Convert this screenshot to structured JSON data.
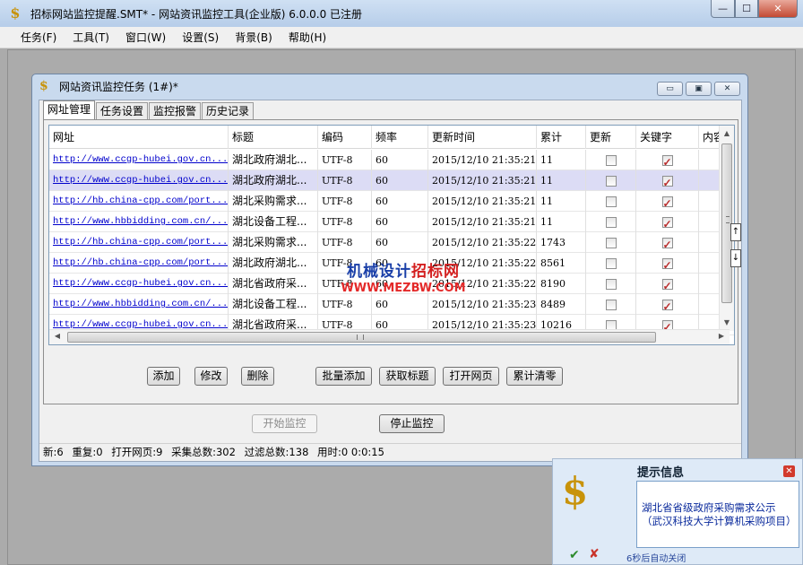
{
  "window": {
    "title": "招标网站监控提醒.SMT* - 网站资讯监控工具(企业版) 6.0.0.0  已注册",
    "min_label": "—",
    "max_label": "☐",
    "close_label": "✕"
  },
  "menu": [
    "任务(F)",
    "工具(T)",
    "窗口(W)",
    "设置(S)",
    "背景(B)",
    "帮助(H)"
  ],
  "child": {
    "title": "网站资讯监控任务  (1#)*",
    "min_label": "▭",
    "restore_label": "▣",
    "close_label": "✕"
  },
  "tabs": [
    "网址管理",
    "任务设置",
    "监控报警",
    "历史记录"
  ],
  "grid": {
    "columns": [
      "网址",
      "标题",
      "编码",
      "频率",
      "更新时间",
      "累计",
      "更新",
      "关键字",
      "内容"
    ],
    "rows": [
      {
        "url": "http://www.ccgp-hubei.gov.cn...",
        "title": "湖北政府湖北...",
        "enc": "UTF-8",
        "freq": "60",
        "time": "2015/12/10 21:35:21",
        "total": "11",
        "update": false,
        "keyword": true,
        "selected": false
      },
      {
        "url": "http://www.ccgp-hubei.gov.cn...",
        "title": "湖北政府湖北...",
        "enc": "UTF-8",
        "freq": "60",
        "time": "2015/12/10 21:35:21",
        "total": "11",
        "update": false,
        "keyword": true,
        "selected": true
      },
      {
        "url": "http://hb.china-cpp.com/port...",
        "title": "湖北采购需求...",
        "enc": "UTF-8",
        "freq": "60",
        "time": "2015/12/10 21:35:21",
        "total": "11",
        "update": false,
        "keyword": true,
        "selected": false
      },
      {
        "url": "http://www.hbbidding.com.cn/...",
        "title": "湖北设备工程...",
        "enc": "UTF-8",
        "freq": "60",
        "time": "2015/12/10 21:35:21",
        "total": "11",
        "update": false,
        "keyword": true,
        "selected": false
      },
      {
        "url": "http://hb.china-cpp.com/port...",
        "title": "湖北采购需求...",
        "enc": "UTF-8",
        "freq": "60",
        "time": "2015/12/10 21:35:22",
        "total": "1743",
        "update": false,
        "keyword": true,
        "selected": false
      },
      {
        "url": "http://hb.china-cpp.com/port...",
        "title": "湖北政府湖北...",
        "enc": "UTF-8",
        "freq": "60",
        "time": "2015/12/10 21:35:22",
        "total": "8561",
        "update": false,
        "keyword": true,
        "selected": false
      },
      {
        "url": "http://www.ccgp-hubei.gov.cn...",
        "title": "湖北省政府采...",
        "enc": "UTF-8",
        "freq": "60",
        "time": "2015/12/10 21:35:22",
        "total": "8190",
        "update": false,
        "keyword": true,
        "selected": false
      },
      {
        "url": "http://www.hbbidding.com.cn/...",
        "title": "湖北设备工程...",
        "enc": "UTF-8",
        "freq": "60",
        "time": "2015/12/10 21:35:23",
        "total": "8489",
        "update": false,
        "keyword": true,
        "selected": false
      },
      {
        "url": "http://www.ccgp-hubei.gov.cn...",
        "title": "湖北省政府采...",
        "enc": "UTF-8",
        "freq": "60",
        "time": "2015/12/10 21:35:23",
        "total": "10216",
        "update": false,
        "keyword": true,
        "selected": false
      }
    ]
  },
  "side_buttons": {
    "up": "↑",
    "down": "↓"
  },
  "buttons": {
    "add": "添加",
    "edit": "修改",
    "delete": "删除",
    "batch_add": "批量添加",
    "fetch_title": "获取标题",
    "open_page": "打开网页",
    "clear_total": "累计清零",
    "start": "开始监控",
    "stop": "停止监控"
  },
  "status": {
    "new": "新:6",
    "repeat": "重复:0",
    "opened": "打开网页:9",
    "collected": "采集总数:302",
    "filtered": "过滤总数:138",
    "elapsed": "用时:0 0:0:15"
  },
  "watermark": {
    "line1a": "机械设计",
    "line1b": "招标网",
    "line2": "WWW.MEZBW.COM"
  },
  "toast": {
    "title": "提示信息",
    "message": "湖北省省级政府采购需求公示（武汉科技大学计算机采购项目）",
    "timer": "6秒后自动关闭",
    "close_label": "✕",
    "ok_label": "✔",
    "cancel_label": "✘"
  },
  "icons": {
    "app": "dollar-key-icon"
  }
}
